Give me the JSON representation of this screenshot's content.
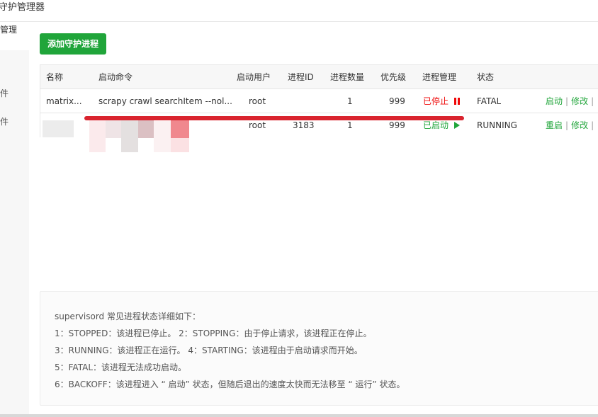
{
  "window": {
    "title": "守护管理器"
  },
  "sidebar": {
    "active": "管理",
    "items": [
      {
        "label": "件"
      },
      {
        "label": "件"
      }
    ]
  },
  "toolbar": {
    "add_label": "添加守护进程"
  },
  "table": {
    "headers": [
      "名称",
      "启动命令",
      "启动用户",
      "进程ID",
      "进程数量",
      "优先级",
      "进程管理",
      "状态"
    ],
    "rows": [
      {
        "name": "matrix...",
        "command": "scrapy crawl searchItem --nol...",
        "user": "root",
        "pid": "",
        "count": "1",
        "priority": "999",
        "manage": "已停止",
        "manage_icon": "pause-icon",
        "status": "FATAL",
        "action1": "启动",
        "action2": "修改"
      },
      {
        "name": "",
        "command": "",
        "user": "root",
        "pid": "3183",
        "count": "1",
        "priority": "999",
        "manage": "已启动",
        "manage_icon": "play-icon",
        "status": "RUNNING",
        "action1": "重启",
        "action2": "修改"
      }
    ]
  },
  "info": {
    "lines": [
      "supervisord 常见进程状态详细如下：",
      "1：STOPPED：该进程已停止。     2：STOPPING：由于停止请求，该进程正在停止。",
      "3：RUNNING：该进程正在运行。  4：STARTING：该进程由于启动请求而开始。",
      "5：FATAL：该进程无法成功启动。",
      "6：BACKOFF：该进程进入 “ 启动” 状态，但随后退出的速度太快而无法移至 “ 运行” 状态。"
    ]
  },
  "colors": {
    "accent": "#20a53a",
    "stopped": "#ef0808",
    "annotation": "#d9232e"
  }
}
